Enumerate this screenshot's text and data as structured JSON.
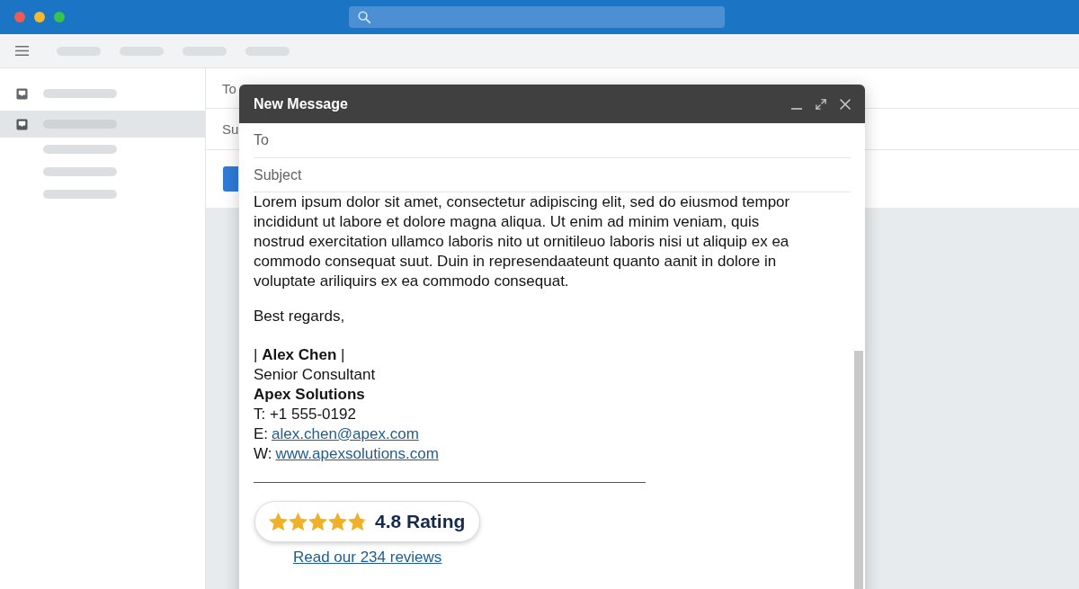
{
  "sidebar": {
    "items": [
      {
        "kind": "folder",
        "selected": false
      },
      {
        "kind": "folder",
        "selected": true
      },
      {
        "kind": "label",
        "selected": false
      },
      {
        "kind": "label",
        "selected": false
      },
      {
        "kind": "label",
        "selected": false
      }
    ]
  },
  "background_form": {
    "to_label": "To",
    "subject_label": "Su"
  },
  "compose": {
    "title": "New Message",
    "to": {
      "placeholder": "To"
    },
    "subject": {
      "placeholder": "Subject"
    },
    "body": "Lorem ipsum dolor sit amet, consectetur adipiscing elit, sed do eiusmod tempor incididunt ut labore et dolore magna aliqua. Ut enim ad minim veniam, quis nostrud exercitation ullamco laboris nito ut ornitileuo laboris nisi ut aliquip ex ea commodo consequat suut. Duin in represendaateunt quanto aanit in dolore in voluptate ariliquirs ex ea commodo consequat.",
    "closing": "Best regards,",
    "signature": {
      "name": "| **Alex Chen** |",
      "title": "Senior Consultant",
      "company": "Apex Solutions",
      "phone": "T: +1 555-0192",
      "email": {
        "label": "E:",
        "link": "alex.chen@apex.com"
      },
      "website": {
        "label": "W:",
        "link": "www.apexsolutions.com"
      }
    },
    "rating": {
      "stars": 4.8,
      "label": "4.8 Rating",
      "reviews_link": "Read our 234 reviews"
    }
  }
}
